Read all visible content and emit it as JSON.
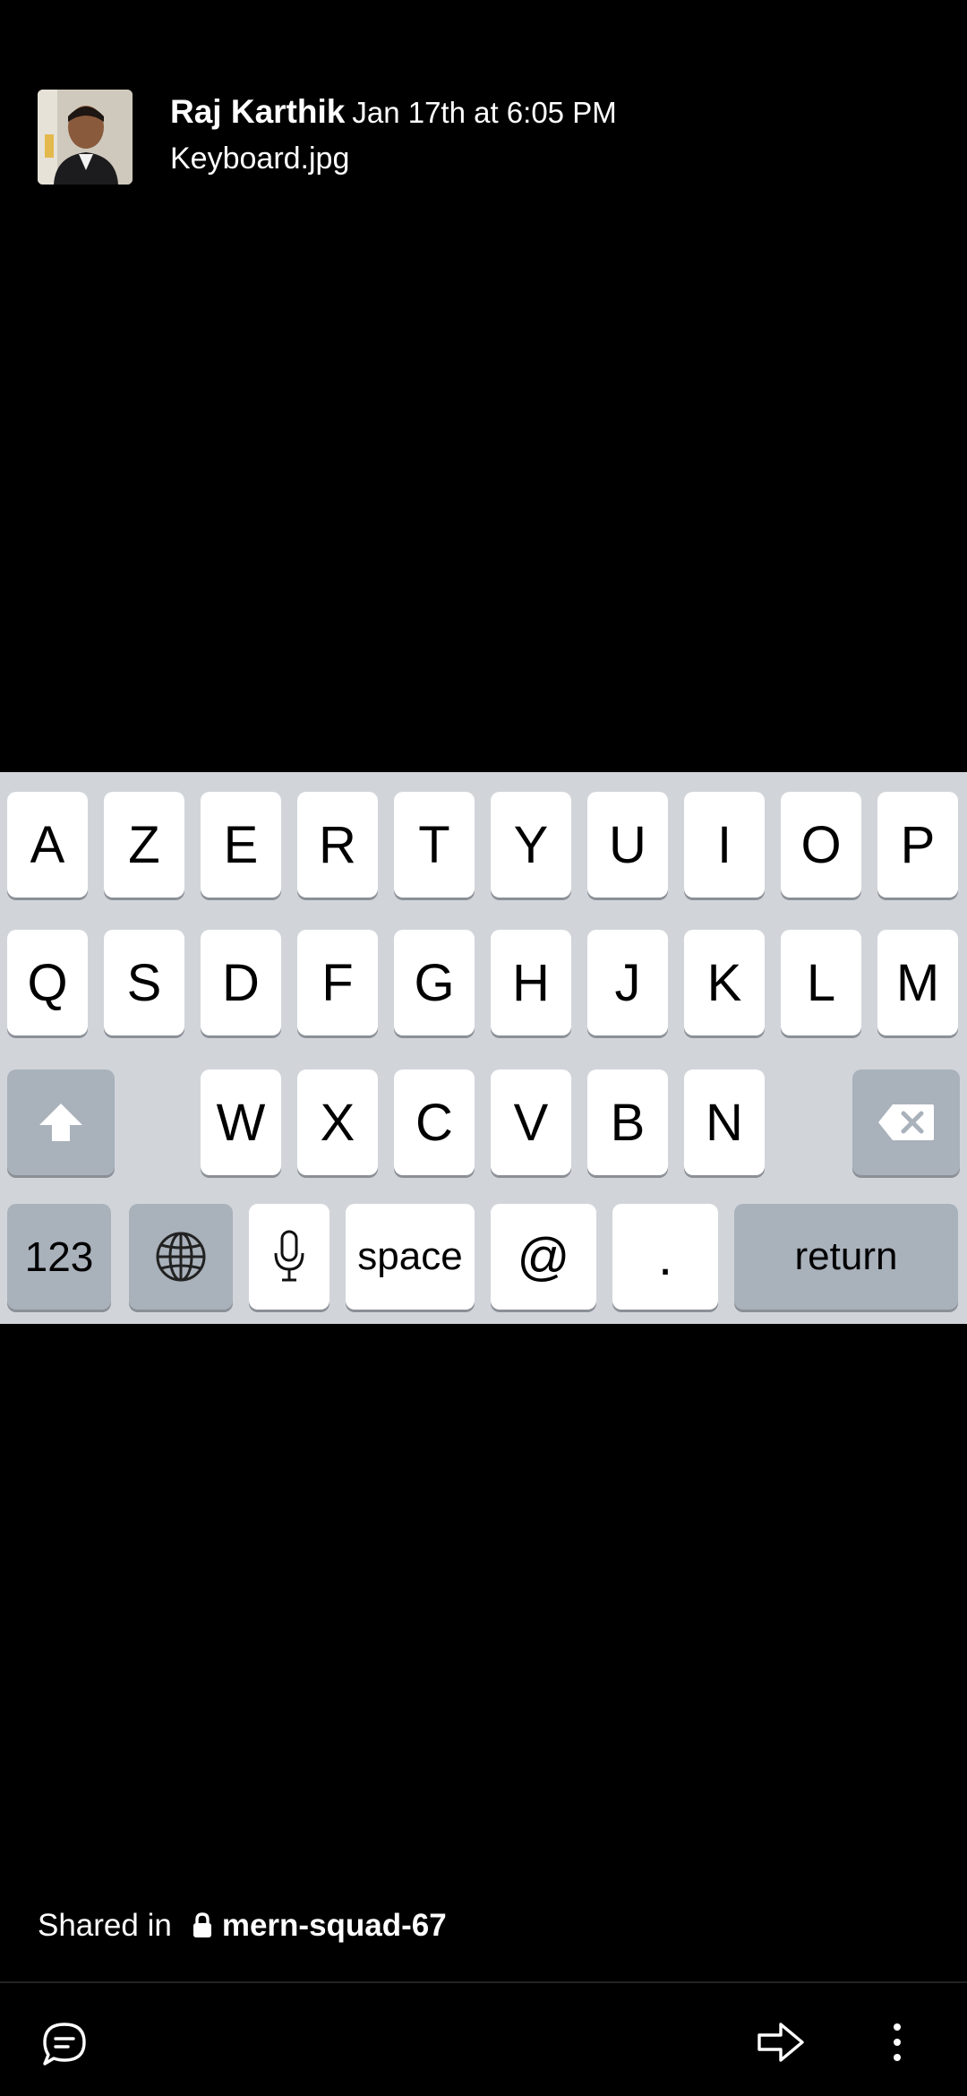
{
  "message": {
    "author": "Raj Karthik",
    "timestamp": "Jan 17th at 6:05 PM",
    "filename": "Keyboard.jpg"
  },
  "keyboard": {
    "row1": [
      "A",
      "Z",
      "E",
      "R",
      "T",
      "Y",
      "U",
      "I",
      "O",
      "P"
    ],
    "row2": [
      "Q",
      "S",
      "D",
      "F",
      "G",
      "H",
      "J",
      "K",
      "L",
      "M"
    ],
    "row3": [
      "W",
      "X",
      "C",
      "V",
      "B",
      "N"
    ],
    "bottom": {
      "numbers": "123",
      "space": "space",
      "at": "@",
      "dot": ".",
      "return": "return"
    }
  },
  "footer": {
    "shared_in": "Shared in",
    "channel": "mern-squad-67"
  },
  "icons": {
    "comment": "comment-icon",
    "share": "share-icon",
    "more": "more-vertical-icon"
  }
}
